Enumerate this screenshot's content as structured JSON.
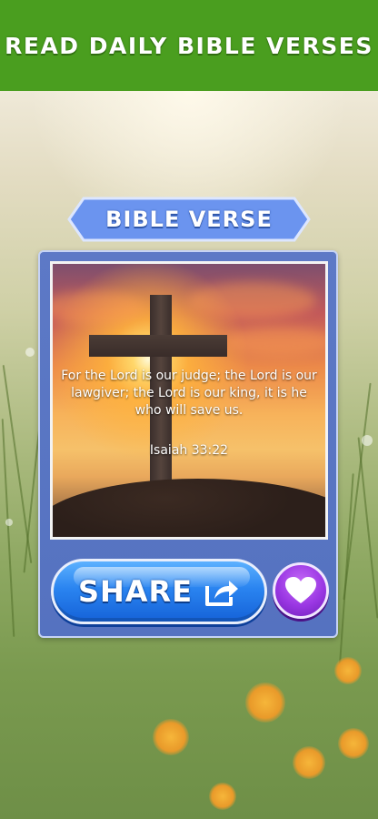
{
  "header": {
    "title": "READ DAILY BIBLE VERSES"
  },
  "banner": {
    "label": "BIBLE VERSE"
  },
  "verse": {
    "text": "For the Lord is our judge; the Lord is our lawgiver; the Lord is our king, it is he who will save us.",
    "reference": "Isaiah 33:22"
  },
  "actions": {
    "share_label": "SHARE",
    "share_icon": "share-arrow-icon",
    "favorite_icon": "heart-icon"
  },
  "colors": {
    "header_bg": "#4a9e1f",
    "banner_bg": "#6b94ef",
    "card_bg": "#5872c2",
    "share_button": "#2a84f0",
    "favorite_button": "#9a37e3"
  }
}
